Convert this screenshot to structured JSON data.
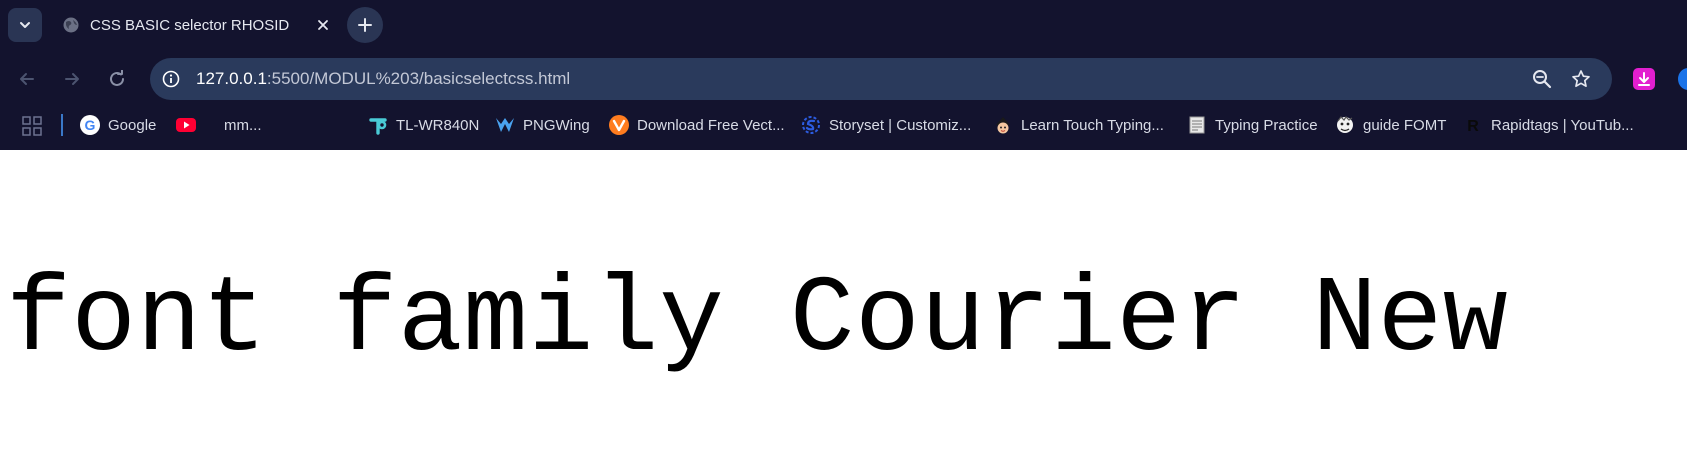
{
  "browser": {
    "tab": {
      "title": "CSS BASIC selector RHOSID",
      "favicon": "globe-icon"
    },
    "address": {
      "host": "127.0.0.1",
      "rest": ":5500/MODUL%203/basicselectcss.html"
    },
    "bookmarks": [
      {
        "label": "Google",
        "icon": "google-icon"
      },
      {
        "label": "",
        "icon": "youtube-icon"
      },
      {
        "label": "mm...",
        "icon": ""
      },
      {
        "label": "TL-WR840N",
        "icon": "tplink-icon"
      },
      {
        "label": "PNGWing",
        "icon": "pngwing-icon"
      },
      {
        "label": "Download Free Vect...",
        "icon": "vecteezy-icon"
      },
      {
        "label": "Storyset | Customiz...",
        "icon": "storyset-icon"
      },
      {
        "label": "Learn Touch Typing...",
        "icon": "typing-icon"
      },
      {
        "label": "Typing Practice",
        "icon": "document-icon"
      },
      {
        "label": "guide FOMT",
        "icon": "guide-icon"
      },
      {
        "label": "Rapidtags | YouTub...",
        "icon": "rapidtags-icon"
      }
    ],
    "colors": {
      "chrome_bg": "#13132e",
      "omnibox_bg": "#2a3a5c",
      "download_ext": "#e21fcf"
    }
  },
  "page": {
    "heading": "font family Courier New"
  }
}
